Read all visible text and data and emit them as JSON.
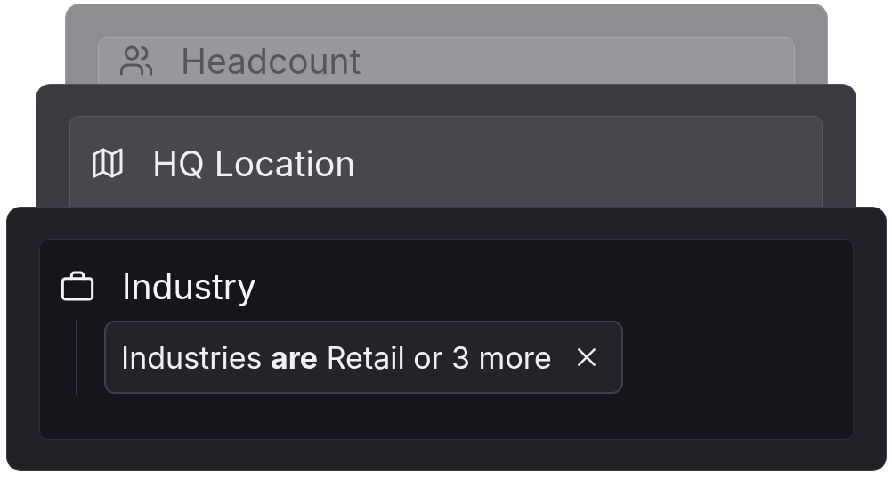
{
  "cards": [
    {
      "label": "Headcount"
    },
    {
      "label": "HQ Location"
    },
    {
      "label": "Industry",
      "filters": [
        {
          "text": "Industries **are** Retail or 3 more"
        }
      ]
    }
  ]
}
